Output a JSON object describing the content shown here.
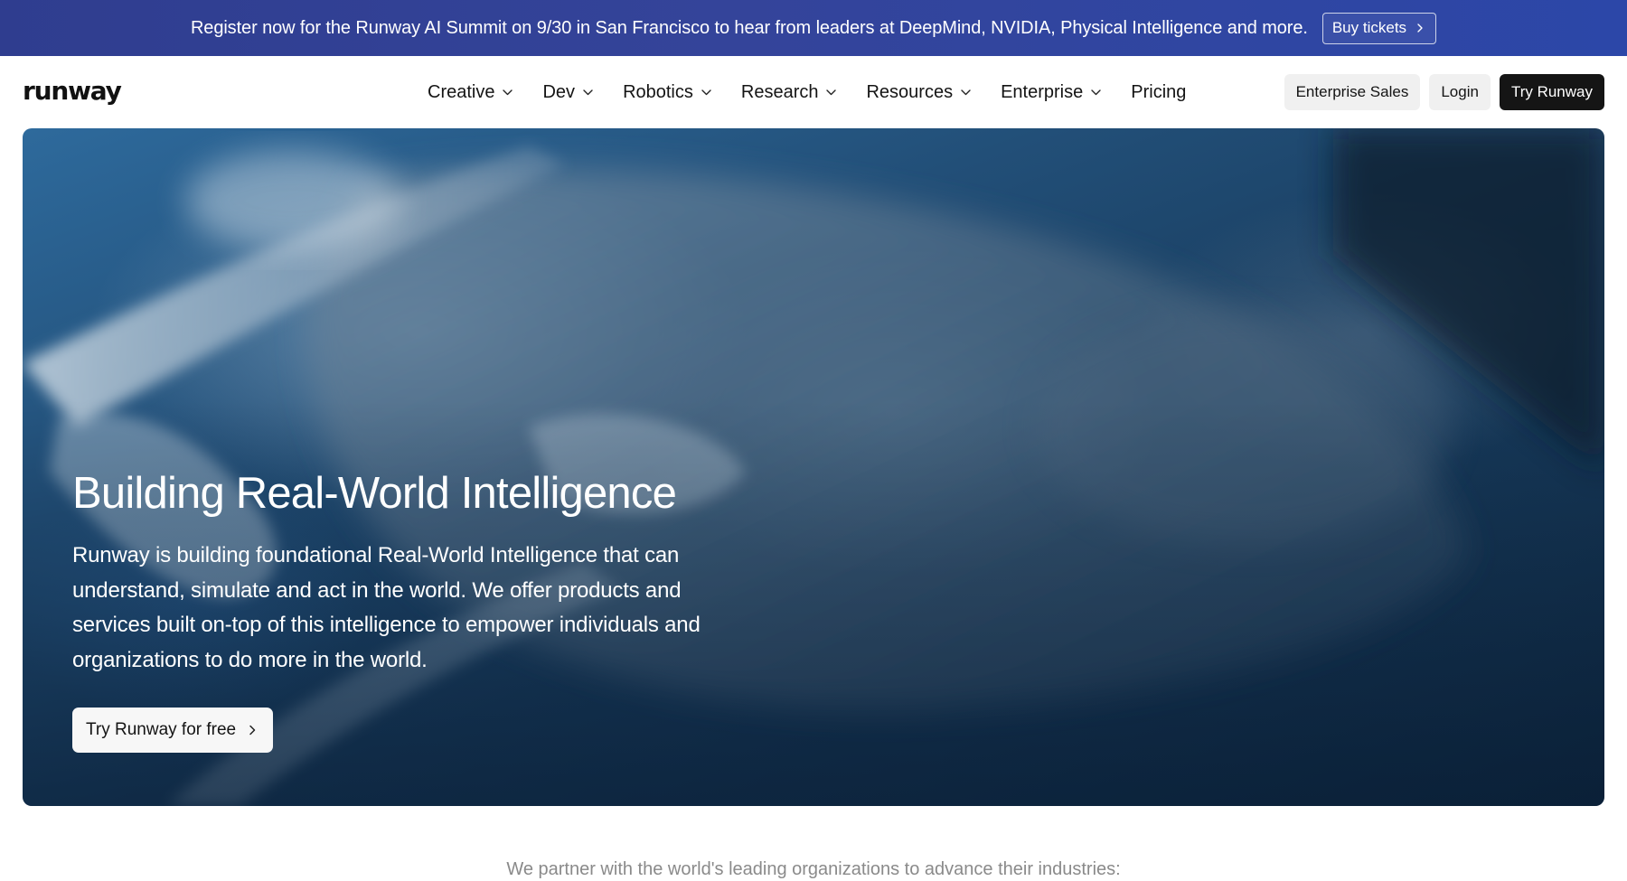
{
  "banner": {
    "text": "Register now for the Runway AI Summit on 9/30 in San Francisco to hear from leaders at DeepMind, NVIDIA, Physical Intelligence and more.",
    "button_label": "Buy tickets",
    "button_icon": "chevron-right-icon",
    "background_color": "#34449a"
  },
  "nav": {
    "logo": "runway",
    "items": [
      {
        "label": "Creative",
        "has_dropdown": true
      },
      {
        "label": "Dev",
        "has_dropdown": true
      },
      {
        "label": "Robotics",
        "has_dropdown": true
      },
      {
        "label": "Research",
        "has_dropdown": true
      },
      {
        "label": "Resources",
        "has_dropdown": true
      },
      {
        "label": "Enterprise",
        "has_dropdown": true
      },
      {
        "label": "Pricing",
        "has_dropdown": false
      }
    ],
    "actions": {
      "enterprise_sales": "Enterprise Sales",
      "login": "Login",
      "try_runway": "Try Runway"
    }
  },
  "hero": {
    "title": "Building Real-World Intelligence",
    "description": "Runway is building foundational Real-World Intelligence that can understand, simulate and act in the world. We offer products and services built on-top of this intelligence to empower individuals and organizations to do more in the world.",
    "cta_label": "Try Runway for free",
    "cta_icon": "chevron-right-icon",
    "image": "underwater-whale"
  },
  "partners": {
    "text": "We partner with the world's leading organizations to advance their industries:"
  }
}
